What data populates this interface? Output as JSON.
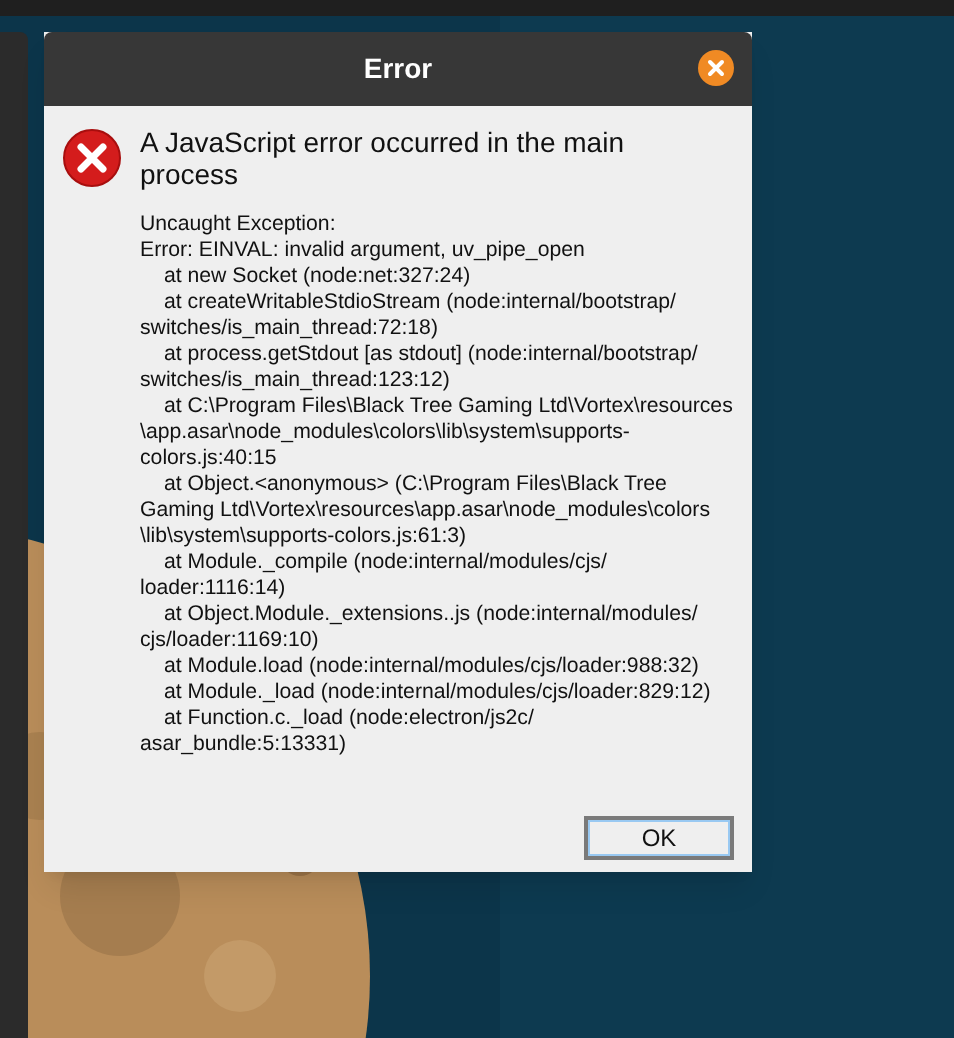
{
  "dialog": {
    "title": "Error",
    "message": "A JavaScript error occurred in the main process",
    "detail": [
      {
        "kind": "head",
        "text": "Uncaught Exception:"
      },
      {
        "kind": "head",
        "text": "Error: EINVAL: invalid argument, uv_pipe_open"
      },
      {
        "kind": "frame",
        "text": "at new Socket (node:net:327:24)"
      },
      {
        "kind": "frame",
        "text": "at createWritableStdioStream (node:internal/bootstrap/"
      },
      {
        "kind": "wrap",
        "text": "switches/is_main_thread:72:18)"
      },
      {
        "kind": "frame",
        "text": "at process.getStdout [as stdout] (node:internal/bootstrap/"
      },
      {
        "kind": "wrap",
        "text": "switches/is_main_thread:123:12)"
      },
      {
        "kind": "frame",
        "text": "at C:\\Program Files\\Black Tree Gaming Ltd\\Vortex\\resources"
      },
      {
        "kind": "wrap",
        "text": "\\app.asar\\node_modules\\colors\\lib\\system\\supports-"
      },
      {
        "kind": "wrap",
        "text": "colors.js:40:15"
      },
      {
        "kind": "frame",
        "text": "at Object.<anonymous> (C:\\Program Files\\Black Tree"
      },
      {
        "kind": "wrap",
        "text": "Gaming Ltd\\Vortex\\resources\\app.asar\\node_modules\\colors"
      },
      {
        "kind": "wrap",
        "text": "\\lib\\system\\supports-colors.js:61:3)"
      },
      {
        "kind": "frame",
        "text": "at Module._compile (node:internal/modules/cjs/"
      },
      {
        "kind": "wrap",
        "text": "loader:1116:14)"
      },
      {
        "kind": "frame",
        "text": "at Object.Module._extensions..js (node:internal/modules/"
      },
      {
        "kind": "wrap",
        "text": "cjs/loader:1169:10)"
      },
      {
        "kind": "frame",
        "text": "at Module.load (node:internal/modules/cjs/loader:988:32)"
      },
      {
        "kind": "frame",
        "text": "at Module._load (node:internal/modules/cjs/loader:829:12)"
      },
      {
        "kind": "frame",
        "text": "at Function.c._load (node:electron/js2c/"
      },
      {
        "kind": "wrap",
        "text": "asar_bundle:5:13331)"
      }
    ],
    "buttons": [
      "OK"
    ]
  }
}
